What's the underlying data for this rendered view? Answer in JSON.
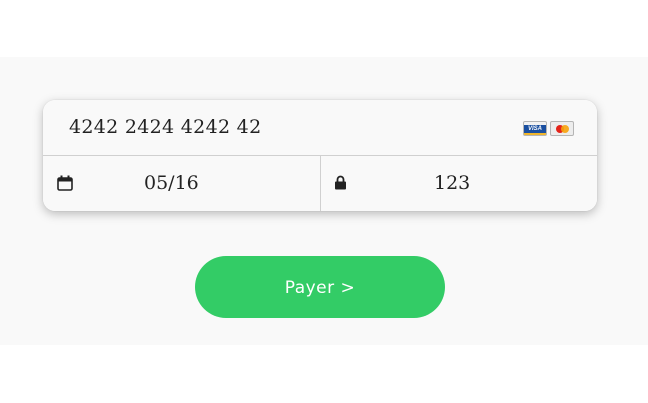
{
  "card": {
    "number": "4242 2424 4242 42",
    "brands": [
      {
        "name": "visa-icon",
        "label": "VISA",
        "color": "#1a4fa0"
      },
      {
        "name": "mastercard-icon",
        "label": "",
        "color": "#e3231a"
      }
    ],
    "expiry": "05/16",
    "cvc": "123"
  },
  "icons": {
    "expiry": "calendar-icon",
    "cvc": "lock-icon"
  },
  "pay_button": {
    "label": "Payer >",
    "color": "#33cc66"
  }
}
